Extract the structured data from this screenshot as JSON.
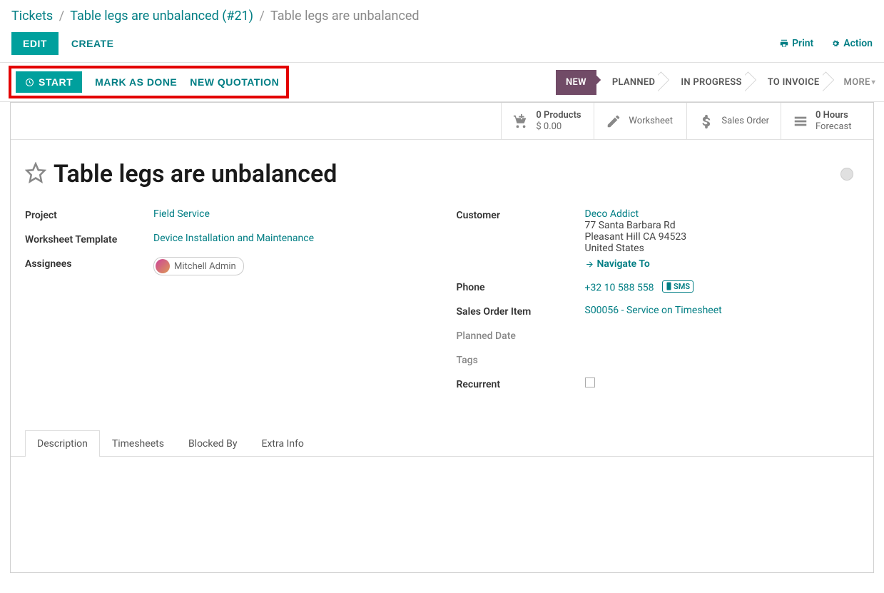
{
  "breadcrumbs": {
    "root": "Tickets",
    "parent": "Table legs are unbalanced (#21)",
    "current": "Table legs are unbalanced"
  },
  "topbar": {
    "edit": "EDIT",
    "create": "CREATE",
    "print": "Print",
    "action": "Action"
  },
  "actions": {
    "start": "START",
    "mark_done": "MARK AS DONE",
    "new_quotation": "NEW QUOTATION"
  },
  "status": {
    "items": [
      "NEW",
      "PLANNED",
      "IN PROGRESS",
      "TO INVOICE"
    ],
    "more": "MORE"
  },
  "stats": {
    "products": {
      "count": "0 Products",
      "sub": "$ 0.00"
    },
    "worksheet": {
      "label": "Worksheet"
    },
    "sales_order": {
      "label": "Sales Order"
    },
    "hours": {
      "count": "0  Hours",
      "sub": "Forecast"
    }
  },
  "record": {
    "title": "Table legs are unbalanced",
    "project_label": "Project",
    "project": "Field Service",
    "wstmpl_label": "Worksheet Template",
    "wstmpl": "Device Installation and Maintenance",
    "assignees_label": "Assignees",
    "assignee": "Mitchell Admin",
    "customer_label": "Customer",
    "customer_name": "Deco Addict",
    "addr1": "77 Santa Barbara Rd",
    "addr2": "Pleasant Hill CA 94523",
    "addr3": "United States",
    "navigate": "Navigate To",
    "phone_label": "Phone",
    "phone": "+32 10 588 558",
    "sms": "SMS",
    "soi_label": "Sales Order Item",
    "soi": "S00056 - Service on Timesheet",
    "planned_label": "Planned Date",
    "tags_label": "Tags",
    "recurrent_label": "Recurrent"
  },
  "tabs": {
    "items": [
      "Description",
      "Timesheets",
      "Blocked By",
      "Extra Info"
    ]
  }
}
